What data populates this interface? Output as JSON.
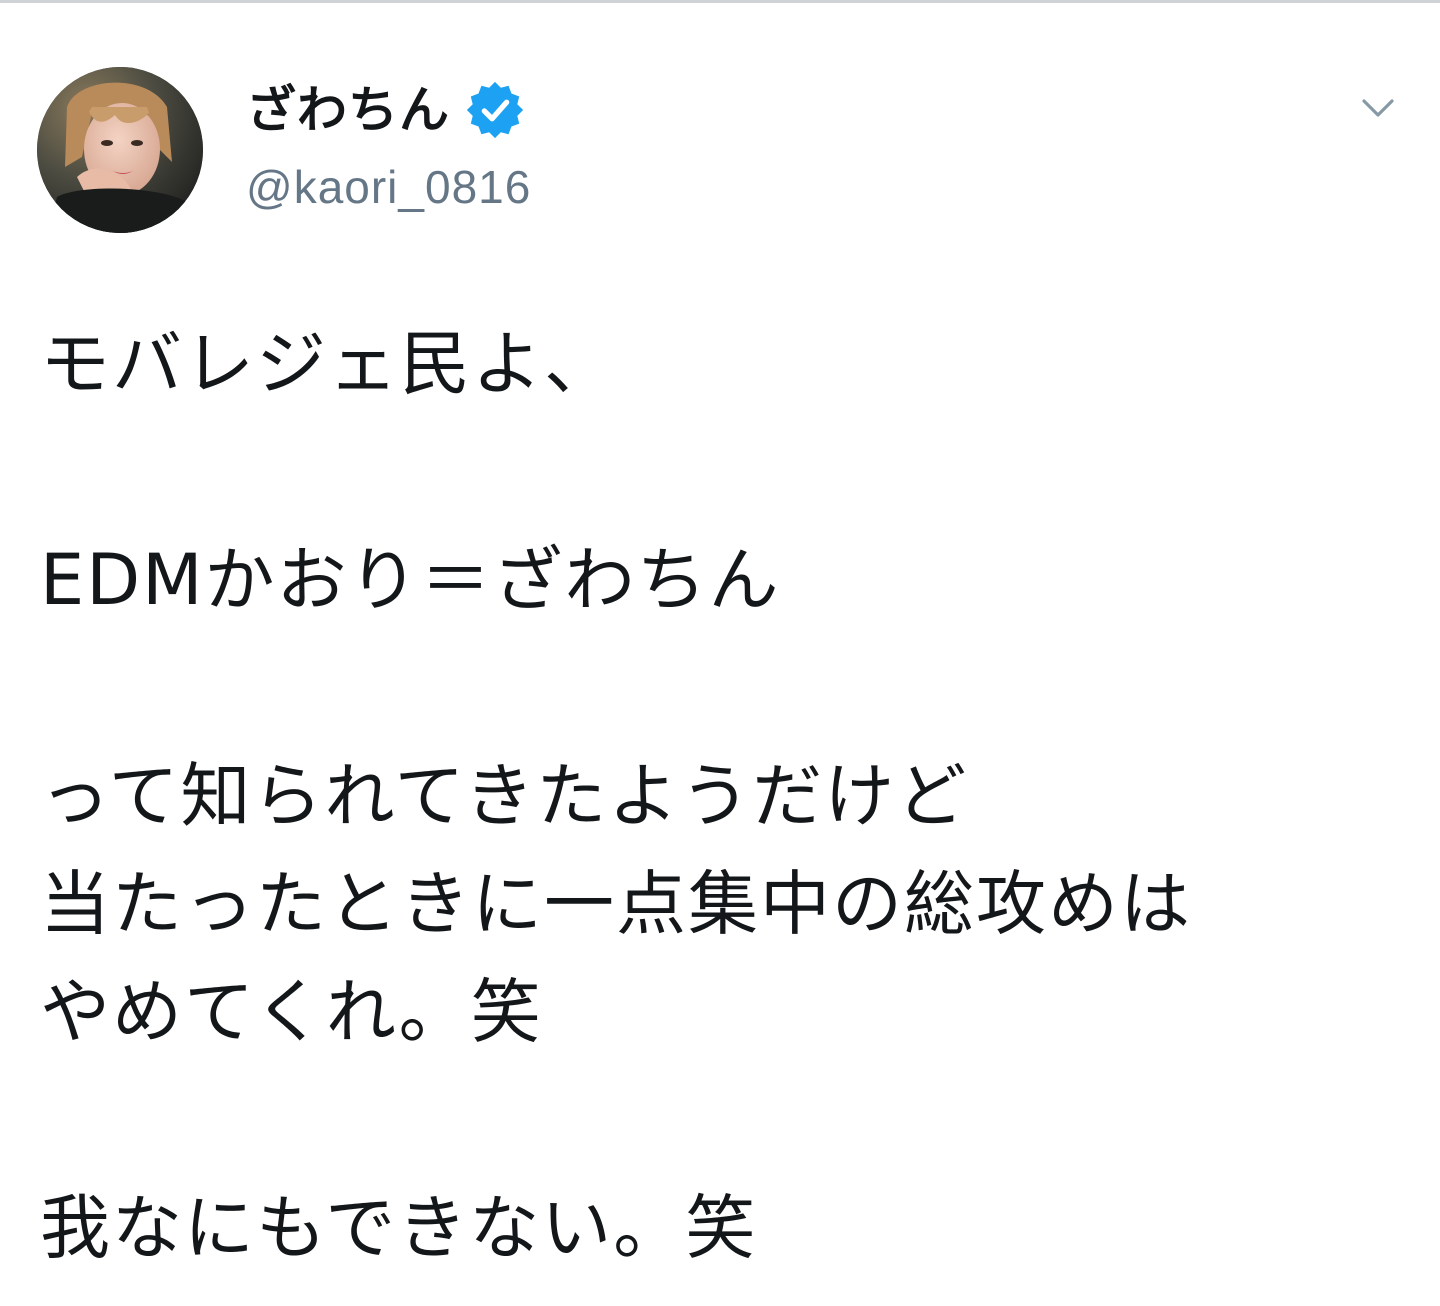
{
  "tweet": {
    "author": {
      "display_name": "ざわちん",
      "handle": "@kaori_0816",
      "verified": true,
      "verified_icon": "verified-badge-icon",
      "avatar_icon": "profile-photo"
    },
    "menu_icon": "chevron-down-icon",
    "lines": [
      "モバレジェ民よ、",
      "",
      "EDMかおり＝ざわちん",
      "",
      "って知られてきたようだけど",
      "当たったときに一点集中の総攻めは",
      "やめてくれ。笑",
      "",
      "我なにもできない。笑"
    ]
  },
  "colors": {
    "text": "#14171a",
    "secondary_text": "#657786",
    "verified_blue": "#1da1f2",
    "chevron": "#8899a6",
    "divider": "#cfd3d6"
  }
}
